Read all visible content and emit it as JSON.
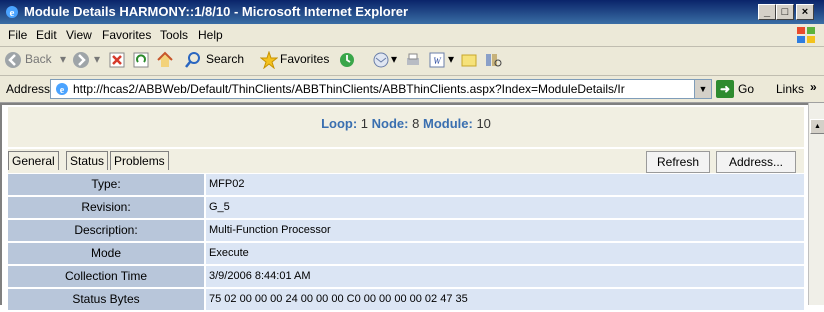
{
  "window": {
    "title": "Module Details HARMONY::1/8/10 - Microsoft Internet Explorer"
  },
  "menu": [
    "File",
    "Edit",
    "View",
    "Favorites",
    "Tools",
    "Help"
  ],
  "toolbar": {
    "back": "Back",
    "search": "Search",
    "favorites": "Favorites"
  },
  "address": {
    "label": "Address",
    "url": "http://hcas2/ABBWeb/Default/ThinClients/ABBThinClients/ABBThinClients.aspx?Index=ModuleDetails/Ir",
    "go": "Go",
    "links": "Links"
  },
  "loop": {
    "loop_label": "Loop:",
    "loop_value": "1",
    "node_label": "Node:",
    "node_value": "8",
    "module_label": "Module:",
    "module_value": "10"
  },
  "tabs": [
    "General",
    "Status",
    "Problems"
  ],
  "buttons": {
    "refresh": "Refresh",
    "address": "Address..."
  },
  "details": [
    {
      "label": "Type:",
      "value": "MFP02"
    },
    {
      "label": "Revision:",
      "value": "G_5"
    },
    {
      "label": "Description:",
      "value": "Multi-Function Processor"
    },
    {
      "label": "Mode",
      "value": "Execute"
    },
    {
      "label": "Collection Time",
      "value": "3/9/2006 8:44:01 AM"
    },
    {
      "label": "Status Bytes",
      "value": "75 02 00 00 00 24 00 00 00 C0 00 00 00 00 02 47 35"
    }
  ]
}
